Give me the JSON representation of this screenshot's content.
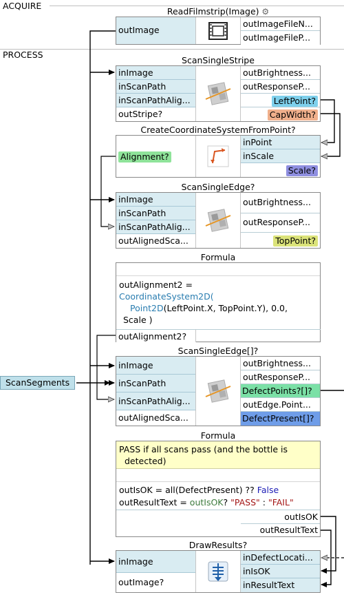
{
  "sections": {
    "acquire": "ACQUIRE",
    "process": "PROCESS"
  },
  "blocks": {
    "read_filmstrip": {
      "title": "ReadFilmstrip(Image)",
      "inputs": [],
      "outputs_left": [
        "outImage"
      ],
      "outputs_right": [
        "outImageFileN...",
        "outImageFileP..."
      ]
    },
    "scan_single_stripe": {
      "title": "ScanSingleStripe",
      "inputs": [
        "inImage",
        "inScanPath",
        "inScanPathAlig..."
      ],
      "outputs_left": [
        "outStripe?"
      ],
      "outputs_right": [
        "outBrightness...",
        "outResponseP...",
        "LeftPoint?",
        "CapWidth?"
      ]
    },
    "create_cs": {
      "title": "CreateCoordinateSystemFromPoint?",
      "outputs_left": [
        "Alignment?"
      ],
      "inputs_right": [
        "inPoint",
        "inScale"
      ],
      "outputs_right": [
        "Scale?"
      ]
    },
    "scan_single_edge": {
      "title": "ScanSingleEdge?",
      "inputs": [
        "inImage",
        "inScanPath",
        "inScanPathAlig..."
      ],
      "outputs_left": [
        "outAlignedSca..."
      ],
      "outputs_right": [
        "outBrightness...",
        "outResponseP...",
        "TopPoint?"
      ]
    },
    "formula1": {
      "title": "Formula",
      "lines": [
        "outAlignment2 =",
        "CoordinateSystem2D(",
        "Point2D(LeftPoint.X, TopPoint.Y), 0.0,",
        "Scale )"
      ],
      "output": "outAlignment2?"
    },
    "scan_single_edge_arr": {
      "title": "ScanSingleEdge[]?",
      "inputs": [
        "inImage",
        "inScanPath",
        "inScanPathAlig..."
      ],
      "outputs_left": [
        "outAlignedSca..."
      ],
      "outputs_right": [
        "outBrightness...",
        "outResponseP...",
        "DefectPoints?[]?",
        "outEdge.Point...",
        "DefectPresent[]?"
      ]
    },
    "formula2": {
      "title": "Formula",
      "comment": [
        "PASS if all scans pass (and the bottle is",
        "detected)"
      ],
      "line1": {
        "a": "outIsOK = all(DefectPresent) ?? ",
        "b": "False"
      },
      "line2": {
        "a": "outResultText = ",
        "b": "outIsOK",
        "c": "? ",
        "d": "\"PASS\"",
        "e": " : ",
        "f": "\"FAIL\""
      },
      "outputs": [
        "outIsOK",
        "outResultText"
      ]
    },
    "draw_results": {
      "title": "DrawResults?",
      "inputs": [
        "inImage"
      ],
      "outputs_left": [
        "outImage?"
      ],
      "inputs_right": [
        "inDefectLocati...",
        "inIsOK",
        "inResultText"
      ]
    }
  },
  "source": {
    "scan_segments": "ScanSegments"
  },
  "colors": {
    "input_bg": "#d9ecf2",
    "left_point": "#7ed0ec",
    "cap_width": "#f0b08c",
    "scale": "#8f8fe0",
    "alignment": "#8fe39a",
    "top_point": "#dbe37a",
    "defect_points": "#7be0a6",
    "defect_present": "#6f9de8",
    "comment_bg": "#ffffc8",
    "keyword": "#2a7db0",
    "string": "#a31515"
  }
}
